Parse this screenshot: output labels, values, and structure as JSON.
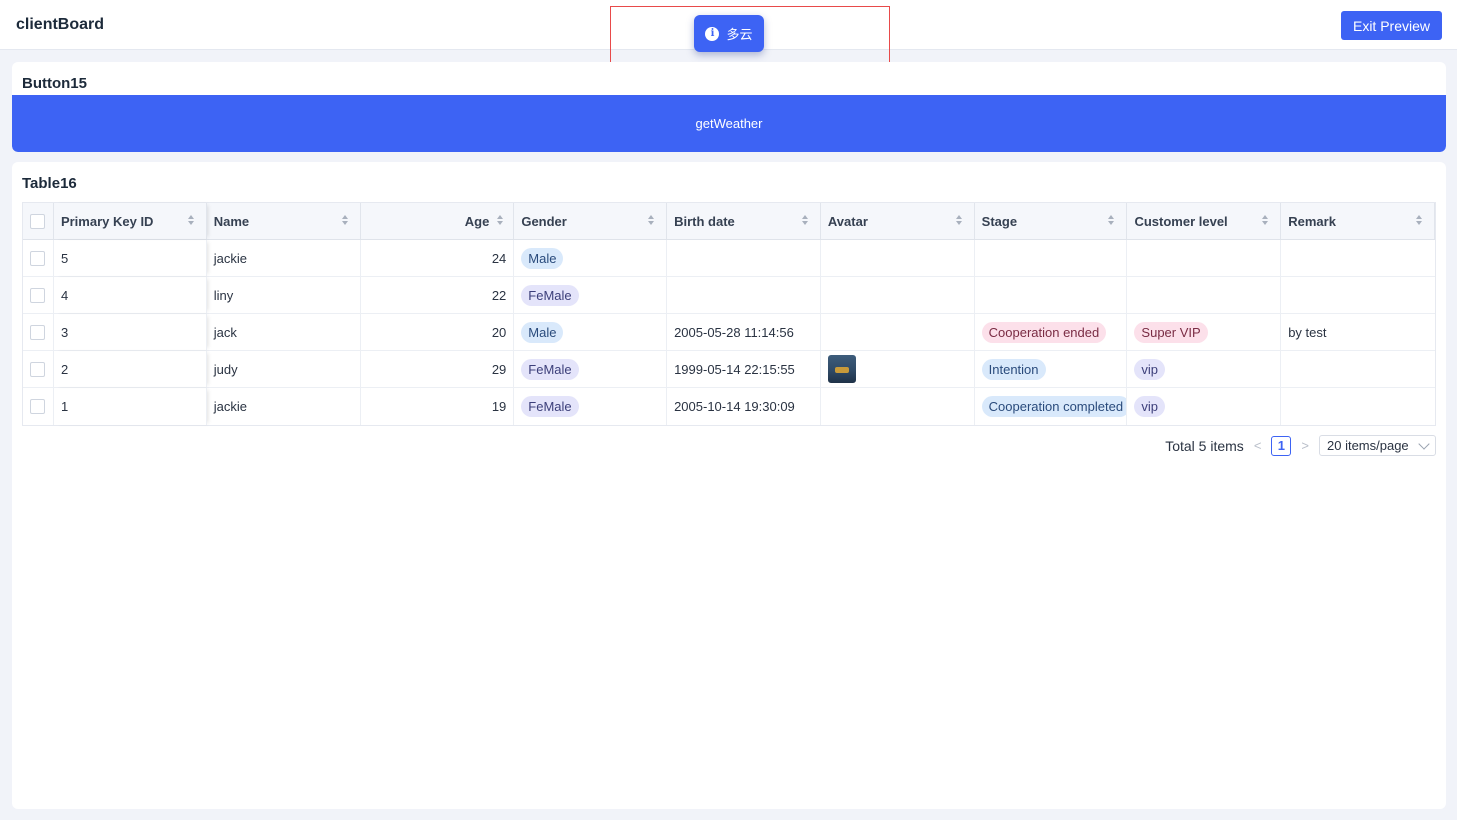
{
  "app": {
    "title": "clientBoard",
    "exit_label": "Exit Preview"
  },
  "toast": {
    "message": "多云",
    "icon": "info-icon"
  },
  "button_card": {
    "title": "Button15",
    "button_label": "getWeather"
  },
  "table_card": {
    "title": "Table16",
    "columns": [
      "Primary Key ID",
      "Name",
      "Age",
      "Gender",
      "Birth date",
      "Avatar",
      "Stage",
      "Customer level",
      "Remark"
    ],
    "rows": [
      {
        "id": "5",
        "name": "jackie",
        "age": "24",
        "gender": "Male",
        "birth": "",
        "avatar": false,
        "stage": "",
        "level": "",
        "remark": ""
      },
      {
        "id": "4",
        "name": "liny",
        "age": "22",
        "gender": "FeMale",
        "birth": "",
        "avatar": false,
        "stage": "",
        "level": "",
        "remark": ""
      },
      {
        "id": "3",
        "name": "jack",
        "age": "20",
        "gender": "Male",
        "birth": "2005-05-28 11:14:56",
        "avatar": false,
        "stage": "Cooperation ended",
        "level": "Super VIP",
        "remark": "by test"
      },
      {
        "id": "2",
        "name": "judy",
        "age": "29",
        "gender": "FeMale",
        "birth": "1999-05-14 22:15:55",
        "avatar": true,
        "stage": "Intention",
        "level": "vip",
        "remark": ""
      },
      {
        "id": "1",
        "name": "jackie",
        "age": "19",
        "gender": "FeMale",
        "birth": "2005-10-14 19:30:09",
        "avatar": false,
        "stage": "Cooperation completed",
        "level": "vip",
        "remark": ""
      }
    ],
    "pagination": {
      "total": "Total 5 items",
      "prev": "<",
      "current_page": "1",
      "next": ">",
      "page_size": "20 items/page"
    }
  },
  "colors": {
    "accent": "#3d63f4",
    "background": "#f1f3f9",
    "toast_outline": "#e84a4a"
  }
}
